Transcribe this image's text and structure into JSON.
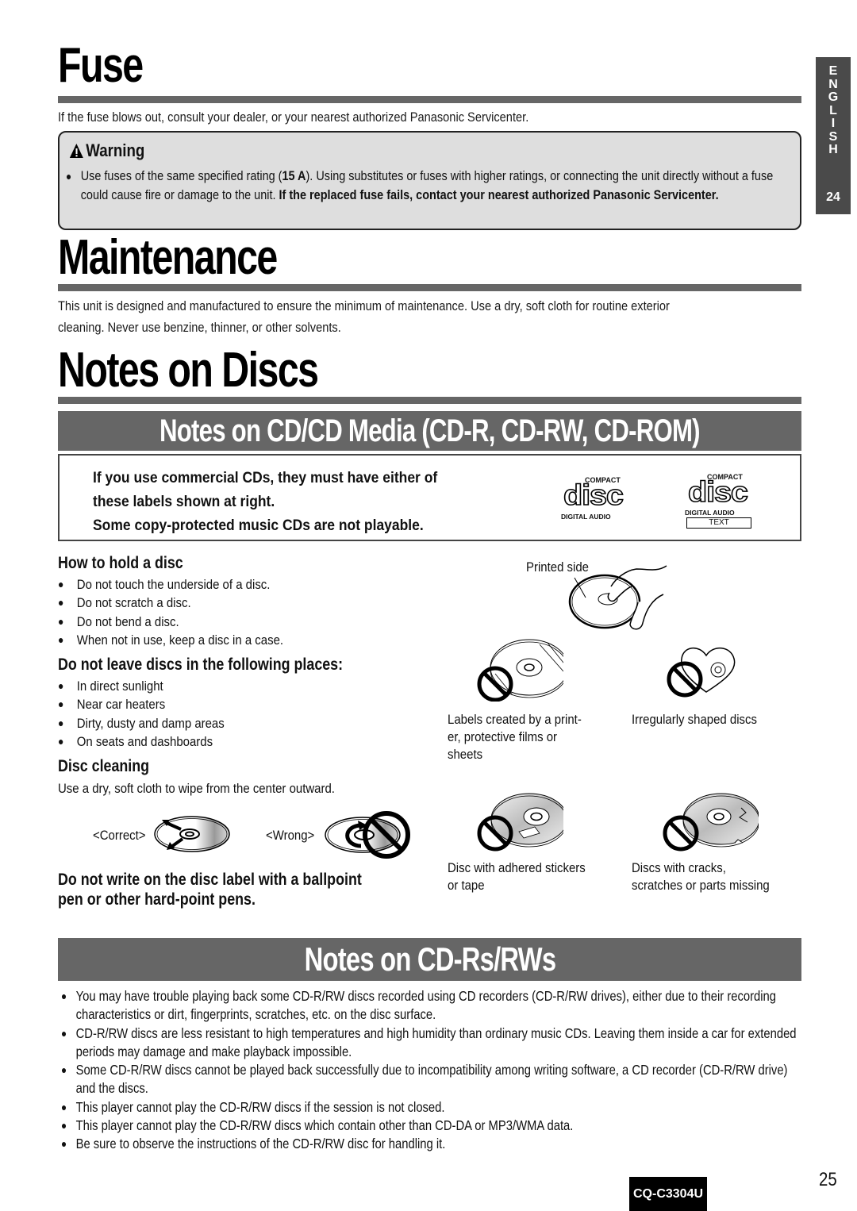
{
  "side_tab": {
    "letters": [
      "E",
      "N",
      "G",
      "L",
      "I",
      "S",
      "H"
    ],
    "page": "24"
  },
  "fuse": {
    "title": "Fuse",
    "intro": "If the fuse blows out, consult your dealer, or your nearest authorized Panasonic Servicenter.",
    "warning": {
      "title": "Warning",
      "icon": "warning-triangle-icon",
      "text_part1": "Use fuses of the same specified rating (",
      "rating": "15 A",
      "text_part2": "). Using substitutes or fuses with higher ratings, or connecting the unit directly without a fuse could cause fire or damage to the unit. ",
      "text_bold": "If the replaced fuse fails, contact your nearest authorized Panasonic Servicenter."
    }
  },
  "maintenance": {
    "title": "Maintenance",
    "line1": "This unit is designed and manufactured to ensure the minimum of maintenance. Use a dry, soft cloth for routine exterior",
    "line2": "cleaning. Never use benzine, thinner, or other solvents."
  },
  "notes_on_discs": {
    "title": "Notes on Discs",
    "cd_media_banner": "Notes on CD/CD Media (CD-R, CD-RW, CD-ROM)",
    "cd_labels": {
      "line1": "If you use commercial CDs, they must have either of",
      "line2": "these labels shown at right.",
      "line3": "Some copy-protected music CDs are not playable.",
      "logo1": {
        "top": "COMPACT",
        "mark": "disc",
        "bottom": "DIGITAL AUDIO"
      },
      "logo2": {
        "top": "COMPACT",
        "mark": "disc",
        "bottom": "DIGITAL AUDIO",
        "extra": "TEXT"
      }
    },
    "how_to_hold": {
      "heading": "How to hold a disc",
      "items": [
        "Do not touch the underside of a disc.",
        "Do not scratch a disc.",
        "Do not bend a disc.",
        "When not in use, keep a disc in a case."
      ],
      "illustration_label": "Printed side"
    },
    "do_not_leave": {
      "heading": "Do not leave discs in the following places:",
      "items": [
        "In direct sunlight",
        "Near car heaters",
        "Dirty, dusty and damp areas",
        "On seats and dashboards"
      ]
    },
    "disc_cleaning": {
      "heading": "Disc cleaning",
      "text": "Use a dry, soft cloth to wipe from the center outward.",
      "correct_label": "<Correct>",
      "wrong_label": "<Wrong>"
    },
    "no_write": {
      "line1": "Do not write on the disc label with a ballpoint",
      "line2": "pen or other hard-point pens."
    },
    "prohibited": [
      {
        "line1": "Labels created by a print-",
        "line2": "er, protective films or",
        "line3": "sheets"
      },
      {
        "line1": "Irregularly shaped discs"
      },
      {
        "line1": "Disc with adhered stickers",
        "line2": "or tape"
      },
      {
        "line1": "Discs with cracks,",
        "line2": "scratches or parts missing"
      }
    ]
  },
  "cdr": {
    "banner": "Notes on CD-Rs/RWs",
    "items": [
      "You may have trouble playing back some CD-R/RW discs recorded using CD recorders (CD-R/RW drives), either due to their recording characteristics or dirt, fingerprints, scratches, etc. on the disc surface.",
      "CD-R/RW discs are less resistant to high temperatures and high humidity than ordinary music CDs. Leaving them inside a car for extended periods may damage and make playback impossible.",
      "Some CD-R/RW discs cannot be played back successfully due to incompatibility among writing software, a CD recorder (CD-R/RW drive) and the discs.",
      "This player cannot play the CD-R/RW discs if the session is not closed.",
      "This player cannot play the CD-R/RW discs which contain other than CD-DA or MP3/WMA data.",
      "Be sure to observe the instructions of the CD-R/RW disc for handling it."
    ]
  },
  "footer": {
    "model": "CQ-C3304U",
    "page": "25"
  },
  "colors": {
    "rule": "#666666",
    "banner": "#666666",
    "warning_bg": "#dedede",
    "side_tab": "#4a4a4a",
    "badge": "#000000"
  }
}
